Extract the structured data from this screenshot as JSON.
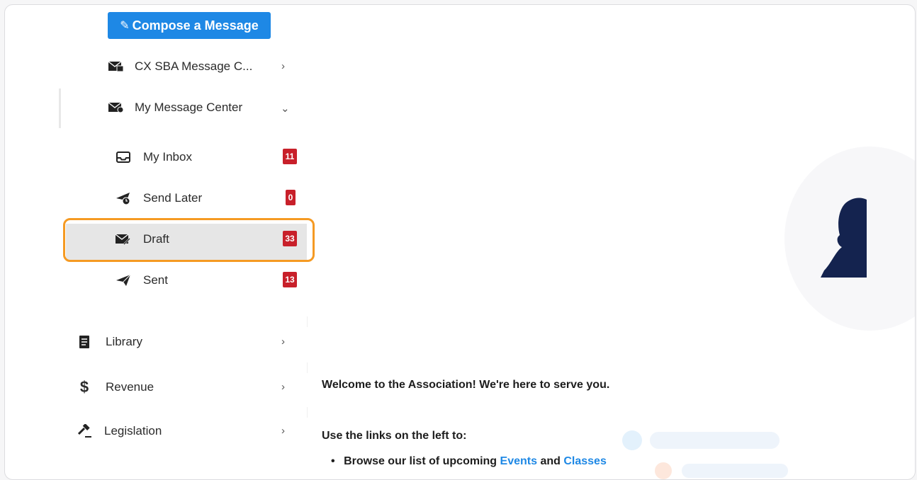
{
  "sidebar": {
    "compose_label": "Compose a Message",
    "items": [
      {
        "label": "CX SBA Message C...",
        "icon": "envelope-building-icon"
      },
      {
        "label": "My Message Center",
        "icon": "envelope-user-icon"
      },
      {
        "label": "My Inbox",
        "icon": "inbox-icon",
        "badge": "11"
      },
      {
        "label": "Send Later",
        "icon": "paper-plane-clock-icon",
        "badge": "0"
      },
      {
        "label": "Draft",
        "icon": "envelope-pencil-icon",
        "badge": "33"
      },
      {
        "label": "Sent",
        "icon": "paper-plane-icon",
        "badge": "13"
      },
      {
        "label": "Library",
        "icon": "document-icon"
      },
      {
        "label": "Revenue",
        "icon": "dollar-icon"
      },
      {
        "label": "Legislation",
        "icon": "gavel-icon"
      }
    ]
  },
  "main": {
    "welcome": "Welcome to the Association!  We're here to serve you.",
    "use_links": "Use the links on the left to:",
    "browse_prefix": "Browse our list of upcoming",
    "browse_link1": "Events",
    "browse_and": "and",
    "browse_link2": "Classes"
  },
  "colors": {
    "accent": "#1e88e5",
    "badge": "#c8202a",
    "highlight": "#f59a23"
  }
}
